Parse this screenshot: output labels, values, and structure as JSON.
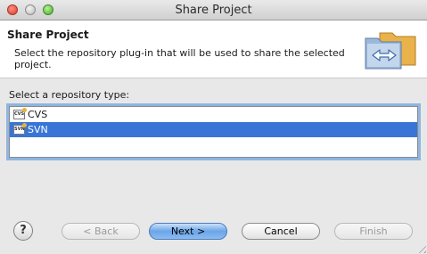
{
  "window": {
    "title": "Share Project"
  },
  "header": {
    "title": "Share Project",
    "description": "Select the repository plug-in that will be used to share the selected project."
  },
  "content": {
    "repo_label": "Select a repository type:",
    "repos": [
      {
        "label": "CVS",
        "icon": "cvs-repo-icon",
        "selected": false
      },
      {
        "label": "SVN",
        "icon": "svn-repo-icon",
        "selected": true
      }
    ]
  },
  "footer": {
    "help_label": "?",
    "back_label": "< Back",
    "next_label": "Next >",
    "cancel_label": "Cancel",
    "finish_label": "Finish"
  },
  "colors": {
    "selection": "#3875d7",
    "list_focus_ring": "#8fb5e0",
    "default_button": "#6aa5e8"
  }
}
